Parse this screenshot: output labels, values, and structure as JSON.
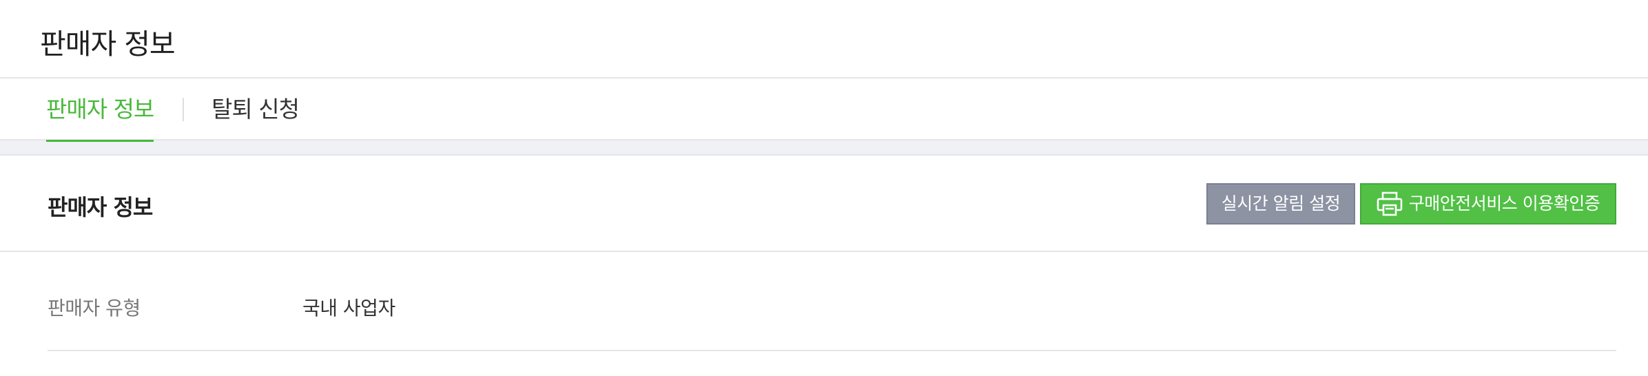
{
  "page": {
    "title": "판매자 정보"
  },
  "tabs": [
    {
      "label": "판매자 정보",
      "active": true
    },
    {
      "label": "탈퇴 신청",
      "active": false
    }
  ],
  "section": {
    "title": "판매자 정보",
    "buttons": {
      "alert_settings": "실시간 알림 설정",
      "purchase_safety_cert": "구매안전서비스 이용확인증",
      "purchase_safety_cert_icon": "printer-icon"
    }
  },
  "info": {
    "seller_type_label": "판매자 유형",
    "seller_type_value": "국내 사업자"
  },
  "colors": {
    "accent_green": "#49b83b",
    "button_gray": "#8d93a3",
    "button_green": "#51c045"
  }
}
